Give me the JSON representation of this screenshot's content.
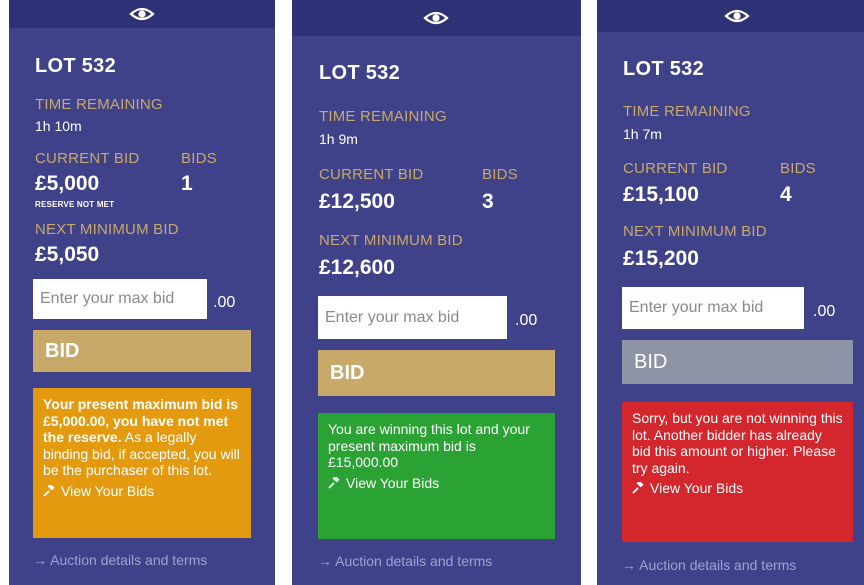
{
  "eye_icon": "eye-icon",
  "hammer_icon": "auction-hammer-icon",
  "colors": {
    "panel": "#3f4189",
    "label_gold": "#c9a96a",
    "bid_button": "#c9a96a",
    "bid_disabled": "#8f93a6",
    "message_warning": "#e49a0f",
    "message_winning": "#2ba334",
    "message_outbid": "#d4262d"
  },
  "panels": [
    {
      "lot": "LOT 532",
      "time_label": "TIME REMAINING",
      "time_value": "1h 10m",
      "current_bid_label": "CURRENT BID",
      "current_bid": "£5,000",
      "bids_label": "BIDS",
      "bids_count": "1",
      "reserve": "RESERVE NOT MET",
      "next_min_label": "NEXT MINIMUM BID",
      "next_min": "£5,050",
      "input_placeholder": "Enter your max bid",
      "cents": ".00",
      "bid_label": "BID",
      "message_bold": "Your present maximum bid is £5,000.00, you have not met the reserve.",
      "message_text": "As a legally binding bid, if accepted, you will be the purchaser of this lot.",
      "view_bids": "View Your Bids",
      "footer": "→ Auction details and terms"
    },
    {
      "lot": "LOT 532",
      "time_label": "TIME REMAINING",
      "time_value": "1h 9m",
      "current_bid_label": "CURRENT BID",
      "current_bid": "£12,500",
      "bids_label": "BIDS",
      "bids_count": "3",
      "next_min_label": "NEXT MINIMUM BID",
      "next_min": "£12,600",
      "input_placeholder": "Enter your max bid",
      "cents": ".00",
      "bid_label": "BID",
      "message_text": "You are winning this lot and your present maximum bid is £15,000.00",
      "view_bids": "View Your Bids",
      "footer": "→ Auction details and terms"
    },
    {
      "lot": "LOT 532",
      "time_label": "TIME REMAINING",
      "time_value": "1h 7m",
      "current_bid_label": "CURRENT BID",
      "current_bid": "£15,100",
      "bids_label": "BIDS",
      "bids_count": "4",
      "next_min_label": "NEXT MINIMUM BID",
      "next_min": "£15,200",
      "input_placeholder": "Enter your max bid",
      "cents": ".00",
      "bid_label": "BID",
      "message_text": "Sorry, but you are not winning this lot. Another bidder has already bid this amount or higher. Please try again.",
      "view_bids": "View Your Bids",
      "footer": "→ Auction details and terms"
    }
  ]
}
